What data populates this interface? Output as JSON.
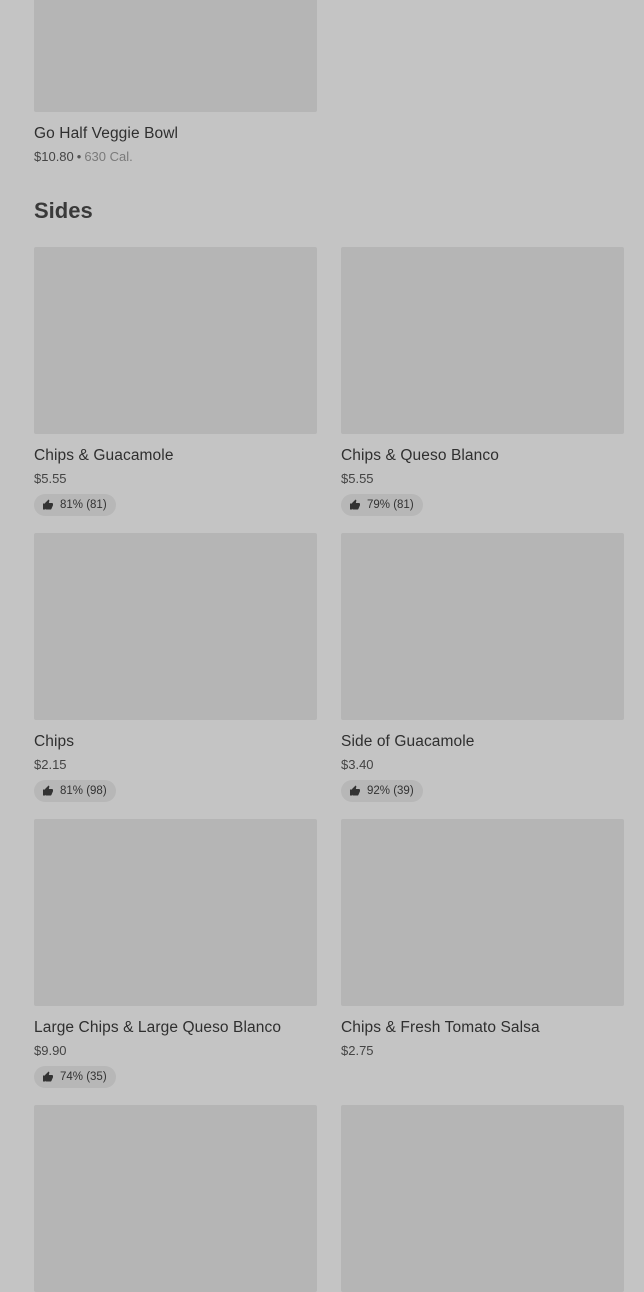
{
  "previous_item": {
    "name": "Go Half Veggie Bowl",
    "price": "$10.80",
    "calories": "630 Cal."
  },
  "section": {
    "title": "Sides"
  },
  "items": [
    {
      "name": "Chips & Guacamole",
      "price": "$5.55",
      "rating": "81% (81)"
    },
    {
      "name": "Chips & Queso Blanco",
      "price": "$5.55",
      "rating": "79% (81)"
    },
    {
      "name": "Chips",
      "price": "$2.15",
      "rating": "81% (98)"
    },
    {
      "name": "Side of Guacamole",
      "price": "$3.40",
      "rating": "92% (39)"
    },
    {
      "name": "Large Chips & Large Queso Blanco",
      "price": "$9.90",
      "rating": "74% (35)"
    },
    {
      "name": "Chips & Fresh Tomato Salsa",
      "price": "$2.75"
    }
  ],
  "icons": {
    "rating": "thumbs-up-icon"
  },
  "colors": {
    "background": "#c4c4c4",
    "image_placeholder": "#b5b5b5",
    "rating_badge": "#b7b7b7"
  }
}
